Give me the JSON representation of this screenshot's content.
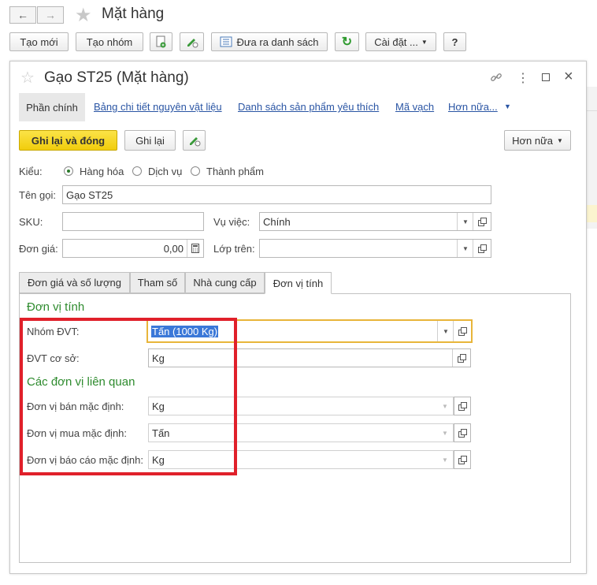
{
  "header": {
    "title": "Mặt hàng",
    "back_icon": "arrow-left-icon",
    "forward_icon": "arrow-right-icon",
    "favorite_icon": "star-icon"
  },
  "toolbar": {
    "create_new": "Tạo mới",
    "create_group": "Tạo nhóm",
    "show_list": "Đưa ra danh sách",
    "settings": "Cài đặt ...",
    "help": "?"
  },
  "form": {
    "title": "Gạo ST25 (Mặt hàng)",
    "nav": {
      "main": "Phần chính",
      "materials": "Bảng chi tiết nguyên vật liệu",
      "favorites": "Danh sách sản phẩm yêu thích",
      "barcode": "Mã vạch",
      "more": "Hơn nữa..."
    },
    "save_close": "Ghi lại và đóng",
    "save": "Ghi lại",
    "more_button": "Hơn nữa",
    "type_label": "Kiểu:",
    "type_options": [
      "Hàng hóa",
      "Dịch vụ",
      "Thành phẩm"
    ],
    "type_selected": "Hàng hóa",
    "name_label": "Tên gọi:",
    "name_value": "Gạo ST25",
    "sku_label": "SKU:",
    "sku_value": "",
    "business_label": "Vụ việc:",
    "business_value": "Chính",
    "price_label": "Đơn giá:",
    "price_value": "0,00",
    "parent_label": "Lớp trên:",
    "parent_value": ""
  },
  "tabs": {
    "price_qty": "Đơn giá và số lượng",
    "params": "Tham số",
    "suppliers": "Nhà cung cấp",
    "units": "Đơn vị tính",
    "active": "Đơn vị tính"
  },
  "units": {
    "section_title": "Đơn vị tính",
    "group_label": "Nhóm ĐVT:",
    "group_value": "Tấn (1000 Kg)",
    "base_label": "ĐVT cơ sở:",
    "base_value": "Kg",
    "related_title": "Các đơn vị liên quan",
    "sale_label": "Đơn vị bán mặc định:",
    "sale_value": "Kg",
    "purchase_label": "Đơn vị mua mặc định:",
    "purchase_value": "Tấn",
    "report_label": "Đơn vị báo cáo mặc định:",
    "report_value": "Kg"
  },
  "colors": {
    "primary_button": "#f5d313",
    "section_title": "#2e8b2e",
    "link": "#2a55a4",
    "highlight_box": "#e0202a",
    "focus_border": "#e8b53a",
    "selection": "#3b78d8"
  }
}
